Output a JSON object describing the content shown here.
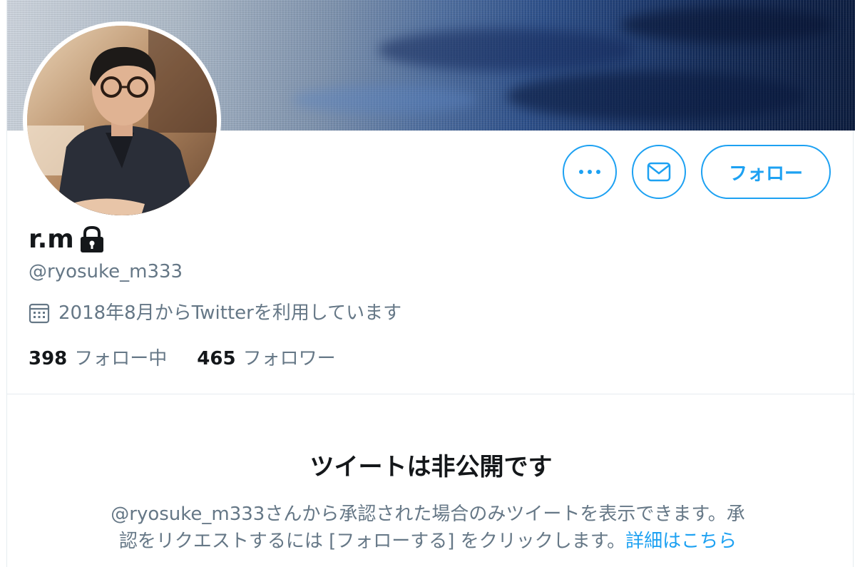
{
  "profile": {
    "display_name": "r.m",
    "handle": "@ryosuke_m333",
    "joined": "2018年8月からTwitterを利用しています",
    "following_count": "398",
    "following_label": "フォロー中",
    "followers_count": "465",
    "followers_label": "フォロワー"
  },
  "actions": {
    "more_icon": "more-horizontal-icon",
    "dm_icon": "envelope-icon",
    "follow_label": "フォロー"
  },
  "protected": {
    "title": "ツイートは非公開です",
    "description": "@ryosuke_m333さんから承認された場合のみツイートを表示できます。承認をリクエストするには [フォローする] をクリックします。",
    "learn_more": "詳細はこちら"
  },
  "icons": {
    "lock": "lock-icon",
    "calendar": "calendar-icon"
  },
  "colors": {
    "accent": "#1da1f2",
    "text_primary": "#14171a",
    "text_secondary": "#657786",
    "border": "#e6ecf0"
  }
}
